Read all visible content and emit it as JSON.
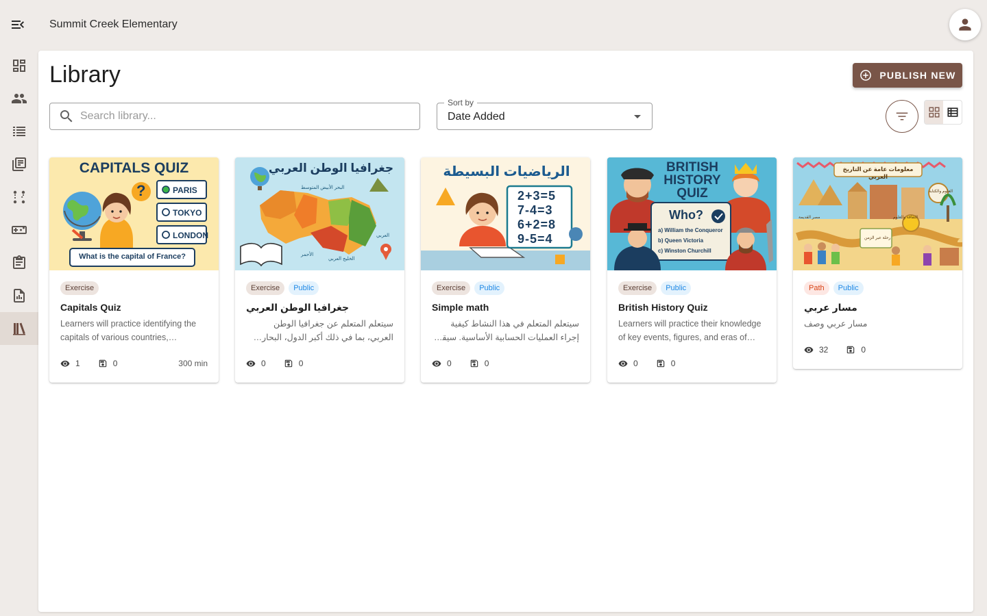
{
  "header": {
    "org_name": "Summit Creek Elementary"
  },
  "sidebar": {
    "items": [
      {
        "name": "dashboard",
        "icon": "dashboard-icon"
      },
      {
        "name": "people",
        "icon": "people-icon"
      },
      {
        "name": "list",
        "icon": "list-icon"
      },
      {
        "name": "articles",
        "icon": "article-icon"
      },
      {
        "name": "paths",
        "icon": "route-icon"
      },
      {
        "name": "games",
        "icon": "gamepad-icon"
      },
      {
        "name": "assignments",
        "icon": "clipboard-icon"
      },
      {
        "name": "reports",
        "icon": "report-icon"
      },
      {
        "name": "library",
        "icon": "library-icon",
        "active": true
      }
    ]
  },
  "page": {
    "title": "Library",
    "publish_label": "PUBLISH NEW",
    "search_placeholder": "Search library...",
    "sort_label": "Sort by",
    "sort_value": "Date Added"
  },
  "cards": [
    {
      "image_title": "CAPITALS QUIZ",
      "image_options": [
        "PARIS",
        "TOKYO",
        "LONDON"
      ],
      "image_question": "What is the capital of France?",
      "chips": [
        "Exercise"
      ],
      "title": "Capitals Quiz",
      "description": "Learners will practice identifying the capitals of various countries, enhancing their geography knowledge.",
      "views": "1",
      "saves": "0",
      "duration": "300 min"
    },
    {
      "image_title": "جغرافيا الوطن العربي",
      "image_labels": [
        "البحر الأبيض المتوسط",
        "العربي",
        "الأحمر",
        "الخليج العربي"
      ],
      "chips": [
        "Exercise",
        "Public"
      ],
      "title": "جغرافيا الوطن العربي",
      "description": "سيتعلم المتعلم عن جغرافيا الوطن العربي، بما في ذلك أكبر الدول، البحار المحيطة، العواصم، وأعلى القمم.",
      "views": "0",
      "saves": "0"
    },
    {
      "image_title": "الرياضيات البسيطة",
      "image_equations": [
        "2+3=5",
        "7-4=3",
        "6+2=8",
        "9-5=4"
      ],
      "chips": [
        "Exercise",
        "Public"
      ],
      "title": "Simple math",
      "description": "سيتعلم المتعلم في هذا النشاط كيفية إجراء العمليات الحسابية الأساسية. سيقوم بحل مسائل رياضية بسيطة.",
      "views": "0",
      "saves": "0"
    },
    {
      "image_title_lines": [
        "BRITISH",
        "HISTORY",
        "QUIZ"
      ],
      "image_who": "Who?",
      "image_options": [
        "a) William the Conqueror",
        "b) Queen Victoria",
        "c) Winston Churchill"
      ],
      "chips": [
        "Exercise",
        "Public"
      ],
      "title": "British History Quiz",
      "description": "Learners will practice their knowledge of key events, figures, and eras of British history.",
      "views": "0",
      "saves": "0"
    },
    {
      "image_title": "معلومات عامة عن التاريخ العربي",
      "image_labels": [
        "مصر القديمة",
        "رحلة عبر الزمن",
        "العلوم والكتابة",
        "الثقافة والعلوم"
      ],
      "chips": [
        "Path",
        "Public"
      ],
      "title": "مسار عربي",
      "description": "مسار عربي وصف",
      "views": "32",
      "saves": "0"
    }
  ],
  "colors": {
    "accent": "#795548",
    "background": "#efebe8",
    "public_chip": "#1e88e5",
    "path_chip": "#d84315"
  }
}
